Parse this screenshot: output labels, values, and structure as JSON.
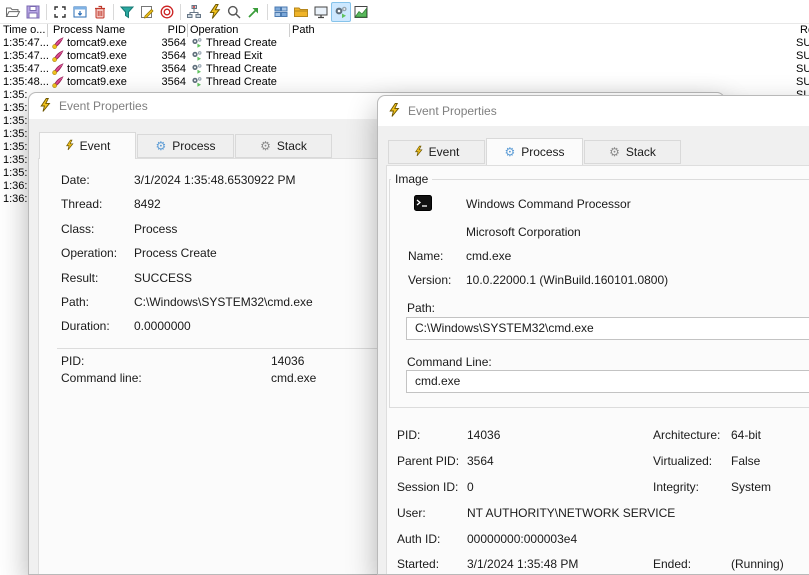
{
  "toolbar": {
    "icons": [
      "open-icon",
      "save-icon",
      "capture-icon",
      "autoscroll-icon",
      "clear-icon",
      "filter-icon",
      "highlight-icon",
      "include-process-icon",
      "process-tree-icon",
      "event-bolt-icon",
      "find-icon",
      "jump-icon",
      "show-registry-icon",
      "show-filesystem-icon",
      "show-network-icon",
      "show-process-thread-icon",
      "show-profiling-icon"
    ],
    "pressed_icon": "show-process-thread-icon"
  },
  "table": {
    "columns": {
      "time": "Time o...",
      "process": "Process Name",
      "pid": "PID",
      "operation": "Operation",
      "path": "Path",
      "result": "Result"
    },
    "rows": [
      {
        "time": "1:35:47...",
        "process": "tomcat9.exe",
        "pid": "3564",
        "operation": "Thread Create",
        "result": "SUCCESS"
      },
      {
        "time": "1:35:47...",
        "process": "tomcat9.exe",
        "pid": "3564",
        "operation": "Thread Exit",
        "result": "SUCCESS"
      },
      {
        "time": "1:35:47...",
        "process": "tomcat9.exe",
        "pid": "3564",
        "operation": "Thread Create",
        "result": "SUCCESS"
      },
      {
        "time": "1:35:48...",
        "process": "tomcat9.exe",
        "pid": "3564",
        "operation": "Thread Create",
        "result": "SUCCESS"
      },
      {
        "time": "1:35:",
        "result": "SUCCESS"
      },
      {
        "time": "1:35:"
      },
      {
        "time": "1:35:"
      },
      {
        "time": "1:35:"
      },
      {
        "time": "1:35:"
      },
      {
        "time": "1:35:"
      },
      {
        "time": "1:35:"
      },
      {
        "time": "1:36:"
      },
      {
        "time": "1:36:"
      }
    ]
  },
  "dialog_event": {
    "title": "Event Properties",
    "tabs": [
      {
        "label": "Event"
      },
      {
        "label": "Process"
      },
      {
        "label": "Stack"
      }
    ],
    "fields": [
      {
        "label": "Date:",
        "value": "3/1/2024 1:35:48.6530922 PM"
      },
      {
        "label": "Thread:",
        "value": "8492"
      },
      {
        "label": "Class:",
        "value": "Process"
      },
      {
        "label": "Operation:",
        "value": "Process Create"
      },
      {
        "label": "Result:",
        "value": "SUCCESS"
      },
      {
        "label": "Path:",
        "value": "C:\\Windows\\SYSTEM32\\cmd.exe"
      },
      {
        "label": "Duration:",
        "value": "0.0000000"
      }
    ],
    "extra_fields": [
      {
        "label": "PID:",
        "value": "14036"
      },
      {
        "label": "Command line:",
        "value": "cmd.exe"
      }
    ]
  },
  "dialog_process": {
    "title": "Event Properties",
    "tabs": [
      {
        "label": "Event"
      },
      {
        "label": "Process"
      },
      {
        "label": "Stack"
      }
    ],
    "group_label": "Image",
    "image": {
      "description": "Windows Command Processor",
      "company": "Microsoft Corporation",
      "name_label": "Name:",
      "name": "cmd.exe",
      "version_label": "Version:",
      "version": "10.0.22000.1 (WinBuild.160101.0800)",
      "path_label": "Path:",
      "path": "C:\\Windows\\SYSTEM32\\cmd.exe",
      "cmdline_label": "Command Line:",
      "cmdline": "cmd.exe"
    },
    "details_left": [
      {
        "label": "PID:",
        "value": "14036"
      },
      {
        "label": "Parent PID:",
        "value": "3564"
      },
      {
        "label": "Session ID:",
        "value": "0"
      },
      {
        "label": "User:",
        "value": "NT AUTHORITY\\NETWORK SERVICE"
      },
      {
        "label": "Auth ID:",
        "value": "00000000:000003e4"
      },
      {
        "label": "Started:",
        "value": "3/1/2024 1:35:48 PM"
      }
    ],
    "details_right": [
      {
        "row": 0,
        "label": "Architecture:",
        "value": "64-bit"
      },
      {
        "row": 1,
        "label": "Virtualized:",
        "value": "False"
      },
      {
        "row": 2,
        "label": "Integrity:",
        "value": "System"
      },
      {
        "row": 5,
        "label": "Ended:",
        "value": "(Running)"
      }
    ]
  },
  "colors": {
    "dialog_bg": "#f0f0f0",
    "page_bg": "#fbfbfb",
    "pressed_toggle": "#cde8ff",
    "bolt_yellow": "#f2c21d",
    "filter_teal": "#2aa8a0",
    "clear_red": "#c0392b",
    "jump_green": "#3a9d3a"
  }
}
